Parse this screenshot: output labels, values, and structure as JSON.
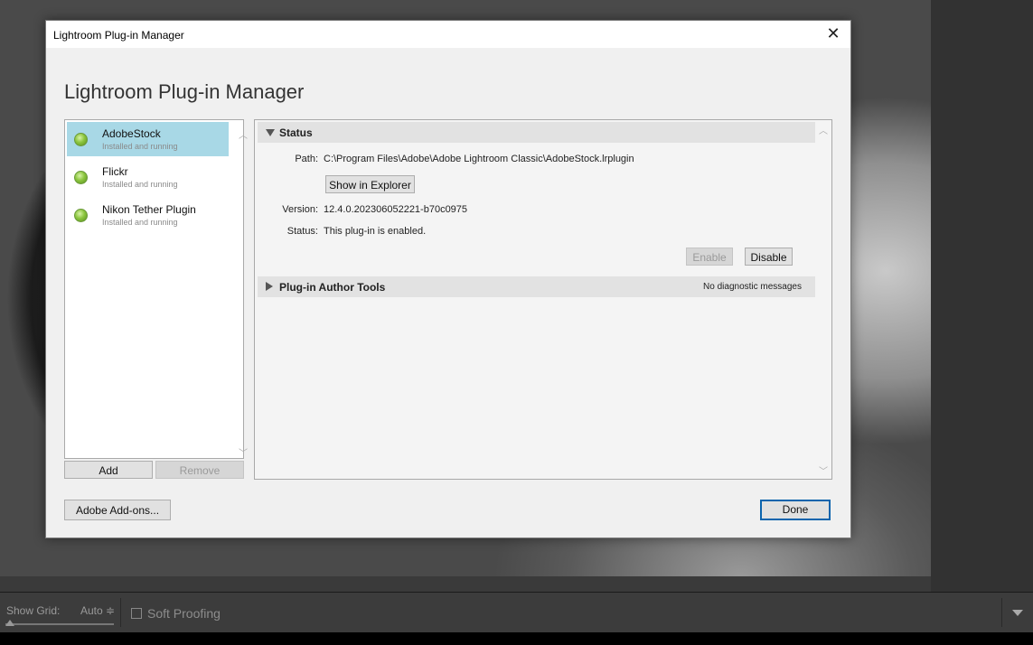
{
  "dialog": {
    "window_title": "Lightroom Plug-in Manager",
    "close_glyph": "✕",
    "heading": "Lightroom Plug-in Manager",
    "plugins": [
      {
        "name": "AdobeStock",
        "status": "Installed and running"
      },
      {
        "name": "Flickr",
        "status": "Installed and running"
      },
      {
        "name": "Nikon Tether Plugin",
        "status": "Installed and running"
      }
    ],
    "add_label": "Add",
    "remove_label": "Remove",
    "addons_label": "Adobe Add-ons...",
    "done_label": "Done",
    "status_section": {
      "title": "Status",
      "path_label": "Path:",
      "path_value": "C:\\Program Files\\Adobe\\Adobe Lightroom Classic\\AdobeStock.lrplugin",
      "show_explorer_label": "Show in Explorer",
      "version_label": "Version:",
      "version_value": "12.4.0.202306052221-b70c0975",
      "status_label": "Status:",
      "status_value": "This plug-in is enabled.",
      "enable_label": "Enable",
      "disable_label": "Disable"
    },
    "author_tools": {
      "title": "Plug-in Author Tools",
      "note": "No diagnostic messages"
    }
  },
  "toolbar": {
    "show_grid_label": "Show Grid:",
    "grid_value": "Auto ≑",
    "soft_proofing_label": "Soft Proofing"
  },
  "colors": {
    "selection": "#a8d8e6",
    "status_dot": "#8cc63f",
    "default_button_border": "#0a64ad"
  }
}
